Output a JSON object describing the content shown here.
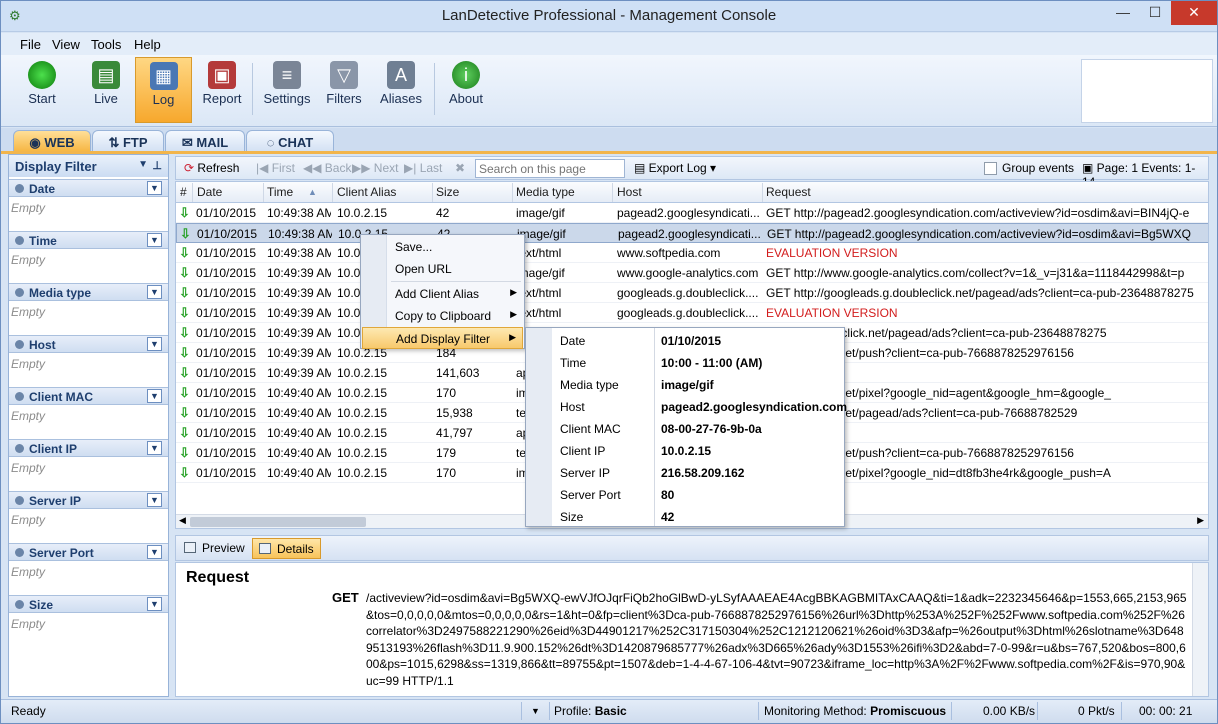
{
  "window": {
    "title": "LanDetective Professional - Management Console"
  },
  "menu": [
    "File",
    "View",
    "Tools",
    "Help"
  ],
  "ribbon": {
    "buttons": [
      "Start",
      "Live",
      "Log",
      "Report",
      "Settings",
      "Filters",
      "Aliases",
      "About"
    ],
    "active": "Log"
  },
  "tabs": [
    "WEB",
    "FTP",
    "MAIL",
    "CHAT"
  ],
  "sidebar": {
    "title": "Display Filter",
    "filters": [
      {
        "label": "Date",
        "value": "Empty"
      },
      {
        "label": "Time",
        "value": "Empty"
      },
      {
        "label": "Media type",
        "value": "Empty"
      },
      {
        "label": "Host",
        "value": "Empty"
      },
      {
        "label": "Client MAC",
        "value": "Empty"
      },
      {
        "label": "Client IP",
        "value": "Empty"
      },
      {
        "label": "Server IP",
        "value": "Empty"
      },
      {
        "label": "Server Port",
        "value": "Empty"
      },
      {
        "label": "Size",
        "value": "Empty"
      }
    ]
  },
  "toolbar": {
    "refresh": "Refresh",
    "first": "First",
    "back": "Back",
    "next": "Next",
    "last": "Last",
    "search_placeholder": "Search on this page",
    "export": "Export Log",
    "group_events": "Group events",
    "page_info": "Page: 1 Events: 1-14"
  },
  "grid": {
    "columns": [
      "#",
      "Date",
      "Time",
      "Client Alias",
      "Size",
      "Media type",
      "Host",
      "Request"
    ],
    "rows": [
      {
        "date": "01/10/2015",
        "time": "10:49:38 AM",
        "alias": "10.0.2.15",
        "size": "42",
        "media": "image/gif",
        "host": "pagead2.googlesyndicati...",
        "request": "GET http://pagead2.googlesyndication.com/activeview?id=osdim&avi=BIN4jQ-e",
        "red": false
      },
      {
        "date": "01/10/2015",
        "time": "10:49:38 AM",
        "alias": "10.0.2.15",
        "size": "42",
        "media": "image/gif",
        "host": "pagead2.googlesyndicati...",
        "request": "GET http://pagead2.googlesyndication.com/activeview?id=osdim&avi=Bg5WXQ",
        "red": false
      },
      {
        "date": "01/10/2015",
        "time": "10:49:38 AM",
        "alias": "10.0.2.15",
        "size": "",
        "media": "text/html",
        "host": "www.softpedia.com",
        "request": "EVALUATION VERSION",
        "red": true
      },
      {
        "date": "01/10/2015",
        "time": "10:49:39 AM",
        "alias": "10.0.2.15",
        "size": "",
        "media": "image/gif",
        "host": "www.google-analytics.com",
        "request": "GET http://www.google-analytics.com/collect?v=1&_v=j31&a=1118442998&t=p",
        "red": false
      },
      {
        "date": "01/10/2015",
        "time": "10:49:39 AM",
        "alias": "10.0.2.15",
        "size": "",
        "media": "text/html",
        "host": "googleads.g.doubleclick....",
        "request": "GET http://googleads.g.doubleclick.net/pagead/ads?client=ca-pub-23648878275",
        "red": false
      },
      {
        "date": "01/10/2015",
        "time": "10:49:39 AM",
        "alias": "10.0.2.15",
        "size": "",
        "media": "text/html",
        "host": "googleads.g.doubleclick....",
        "request": "EVALUATION VERSION",
        "red": true
      },
      {
        "date": "01/10/2015",
        "time": "10:49:39 AM",
        "alias": "10.0.2.15",
        "size": "",
        "media": "",
        "host": "",
        "request": "eads.g.doubleclick.net/pagead/ads?client=ca-pub-23648878275",
        "red": false
      },
      {
        "date": "01/10/2015",
        "time": "10:49:39 AM",
        "alias": "10.0.2.15",
        "size": "184",
        "media": "",
        "host": "",
        "request": "g.doubleclick.net/push?client=ca-pub-7668878252976156",
        "red": false
      },
      {
        "date": "01/10/2015",
        "time": "10:49:39 AM",
        "alias": "10.0.2.15",
        "size": "141,603",
        "media": "ap",
        "host": "",
        "request": "RSION",
        "red": true
      },
      {
        "date": "01/10/2015",
        "time": "10:49:40 AM",
        "alias": "10.0.2.15",
        "size": "170",
        "media": "im",
        "host": "",
        "request": "g.doubleclick.net/pixel?google_nid=agent&google_hm=&google_",
        "red": false
      },
      {
        "date": "01/10/2015",
        "time": "10:49:40 AM",
        "alias": "10.0.2.15",
        "size": "15,938",
        "media": "te",
        "host": "",
        "request": "g.doubleclick.net/pagead/ads?client=ca-pub-76688782529",
        "red": false
      },
      {
        "date": "01/10/2015",
        "time": "10:49:40 AM",
        "alias": "10.0.2.15",
        "size": "41,797",
        "media": "ap",
        "host": "",
        "request": "RSION",
        "red": true
      },
      {
        "date": "01/10/2015",
        "time": "10:49:40 AM",
        "alias": "10.0.2.15",
        "size": "179",
        "media": "te",
        "host": "",
        "request": "g.doubleclick.net/push?client=ca-pub-7668878252976156",
        "red": false
      },
      {
        "date": "01/10/2015",
        "time": "10:49:40 AM",
        "alias": "10.0.2.15",
        "size": "170",
        "media": "im",
        "host": "",
        "request": "g.doubleclick.net/pixel?google_nid=dt8fb3he4rk&google_push=A",
        "red": false
      }
    ]
  },
  "context_menu": {
    "items": [
      "Save...",
      "Open URL",
      "Add Client Alias",
      "Copy to Clipboard",
      "Add Display Filter"
    ]
  },
  "submenu": {
    "items": [
      {
        "k": "Date",
        "v": "01/10/2015"
      },
      {
        "k": "Time",
        "v": "10:00 - 11:00 (AM)"
      },
      {
        "k": "Media type",
        "v": "image/gif"
      },
      {
        "k": "Host",
        "v": "pagead2.googlesyndication.com"
      },
      {
        "k": "Client MAC",
        "v": "08-00-27-76-9b-0a"
      },
      {
        "k": "Client IP",
        "v": "10.0.2.15"
      },
      {
        "k": "Server IP",
        "v": "216.58.209.162"
      },
      {
        "k": "Server Port",
        "v": "80"
      },
      {
        "k": "Size",
        "v": "42"
      }
    ]
  },
  "lower_tabs": [
    "Preview",
    "Details"
  ],
  "details": {
    "title": "Request",
    "method": "GET",
    "text": "/activeview?id=osdim&avi=Bg5WXQ-ewVJfOJqrFiQb2hoGlBwD-yLSyfAAAEAE4AcgBBKAGBMITAxCAAQ&ti=1&adk=2232345646&p=1553,665,2153,965&tos=0,0,0,0,0&mtos=0,0,0,0,0&rs=1&ht=0&fp=client%3Dca-pub-7668878252976156%26url%3Dhttp%253A%252F%252Fwww.softpedia.com%252F%26correlator%3D2497588221290%26eid%3D44901217%252C317150304%252C1212120621%26oid%3D3&afp=%26output%3Dhtml%26slotname%3D6489513193%26flash%3D11.9.900.152%26dt%3D1420879685777%26adx%3D665%26ady%3D1553%26ifi%3D2&abd=7-0-99&r=u&bs=767,520&bos=800,600&ps=1015,6298&ss=1319,866&tt=89755&pt=1507&deb=1-4-4-67-106-4&tvt=90723&iframe_loc=http%3A%2F%2Fwww.softpedia.com%2F&is=970,90&uc=99 HTTP/1.1"
  },
  "status": {
    "ready": "Ready",
    "profile_label": "Profile:",
    "profile": "Basic",
    "method_label": "Monitoring Method:",
    "method": "Promiscuous",
    "rate": "0.00 KB/s",
    "pkt": "0 Pkt/s",
    "time": "00: 00: 21"
  }
}
